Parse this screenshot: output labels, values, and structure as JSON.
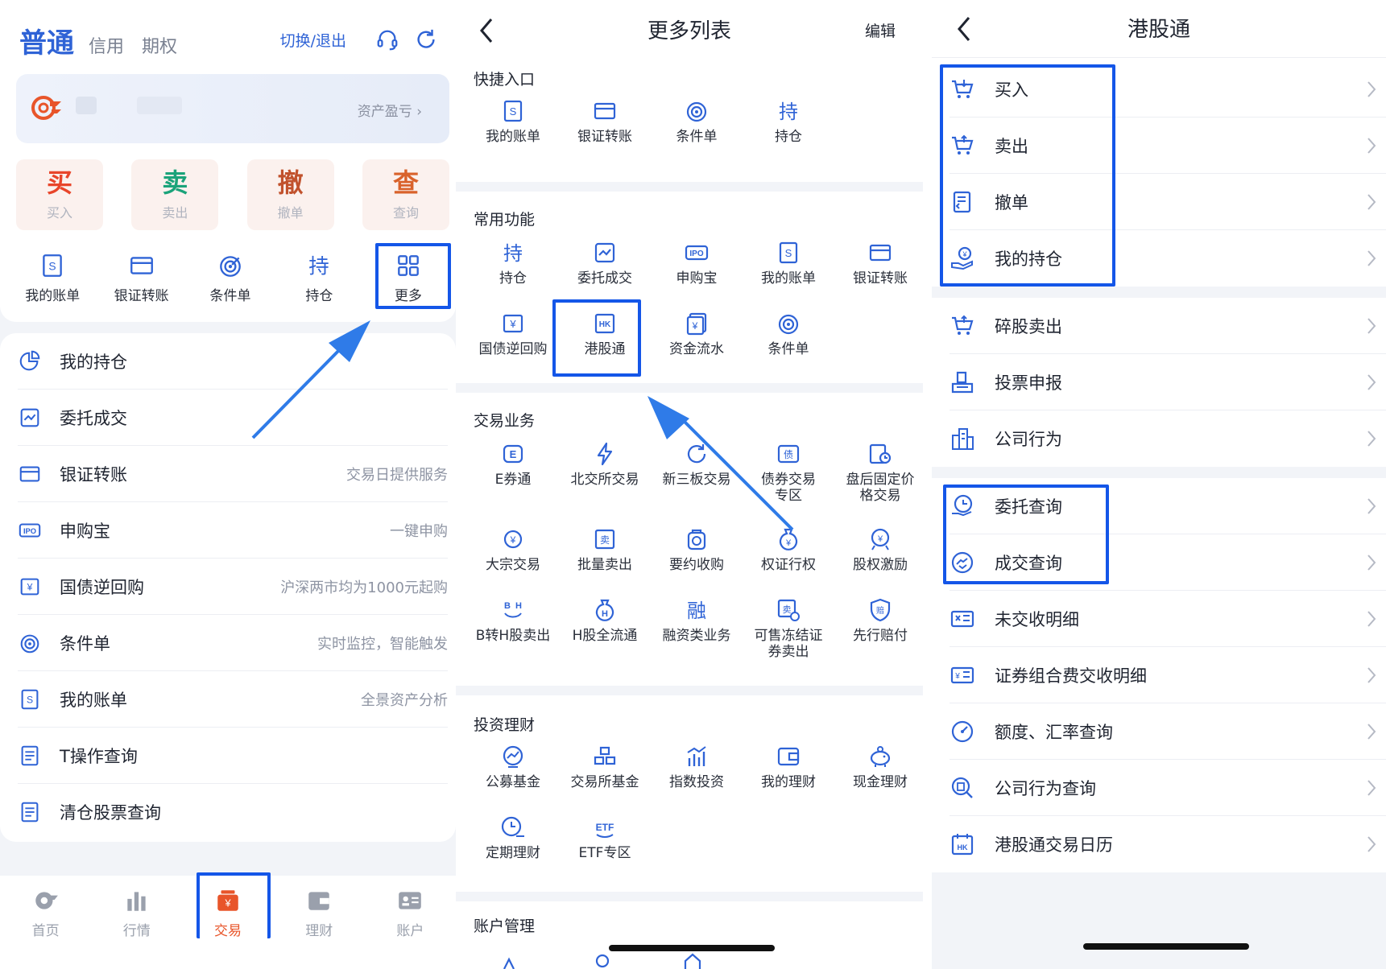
{
  "colors": {
    "accent": "#2f63d6",
    "highlight": "#1456e8",
    "buy": "#e8452a",
    "sell": "#1aa37a",
    "cancel": "#c1522d",
    "query": "#d9622b",
    "tab_active": "#e8552a"
  },
  "panel_trade": {
    "modes": [
      "普通",
      "信用",
      "期权"
    ],
    "switch_link": "切换/退出",
    "icons_right": [
      "headset-icon",
      "refresh-icon"
    ],
    "asset_link": "资产盈亏 ›",
    "quick_actions": [
      {
        "big": "买",
        "small": "买入"
      },
      {
        "big": "卖",
        "small": "卖出"
      },
      {
        "big": "撤",
        "small": "撤单"
      },
      {
        "big": "查",
        "small": "查询"
      }
    ],
    "shortcuts": [
      "我的账单",
      "银证转账",
      "条件单",
      "持仓",
      "更多"
    ],
    "list": [
      {
        "title": "我的持仓",
        "hint": ""
      },
      {
        "title": "委托成交",
        "hint": ""
      },
      {
        "title": "银证转账",
        "hint": "交易日提供服务"
      },
      {
        "title": "申购宝",
        "hint": "一键申购"
      },
      {
        "title": "国债逆回购",
        "hint": "沪深两市均为1000元起购"
      },
      {
        "title": "条件单",
        "hint": "实时监控，智能触发"
      },
      {
        "title": "我的账单",
        "hint": "全景资产分析"
      },
      {
        "title": "T操作查询",
        "hint": ""
      },
      {
        "title": "清仓股票查询",
        "hint": ""
      }
    ],
    "tabs": [
      "首页",
      "行情",
      "交易",
      "理财",
      "账户"
    ]
  },
  "panel_more": {
    "title": "更多列表",
    "edit": "编辑",
    "sections": [
      {
        "title": "快捷入口",
        "items": [
          "我的账单",
          "银证转账",
          "条件单",
          "持仓"
        ]
      },
      {
        "title": "常用功能",
        "items": [
          "持仓",
          "委托成交",
          "申购宝",
          "我的账单",
          "银证转账",
          "国债逆回购",
          "港股通",
          "资金流水",
          "条件单"
        ]
      },
      {
        "title": "交易业务",
        "items": [
          "E券通",
          "北交所交易",
          "新三板交易",
          "债券交易\n专区",
          "盘后固定价\n格交易",
          "大宗交易",
          "批量卖出",
          "要约收购",
          "权证行权",
          "股权激励",
          "B转H股卖出",
          "H股全流通",
          "融资类业务",
          "可售冻结证\n券卖出",
          "先行赔付"
        ]
      },
      {
        "title": "投资理财",
        "items": [
          "公募基金",
          "交易所基金",
          "指数投资",
          "我的理财",
          "现金理财",
          "定期理财",
          "ETF专区"
        ]
      },
      {
        "title": "账户管理",
        "items": []
      }
    ]
  },
  "panel_hk": {
    "title": "港股通",
    "groups": [
      [
        "买入",
        "卖出",
        "撤单",
        "我的持仓"
      ],
      [
        "碎股卖出",
        "投票申报",
        "公司行为"
      ],
      [
        "委托查询",
        "成交查询",
        "未交收明细",
        "证券组合费交收明细",
        "额度、汇率查询",
        "公司行为查询",
        "港股通交易日历"
      ]
    ]
  }
}
